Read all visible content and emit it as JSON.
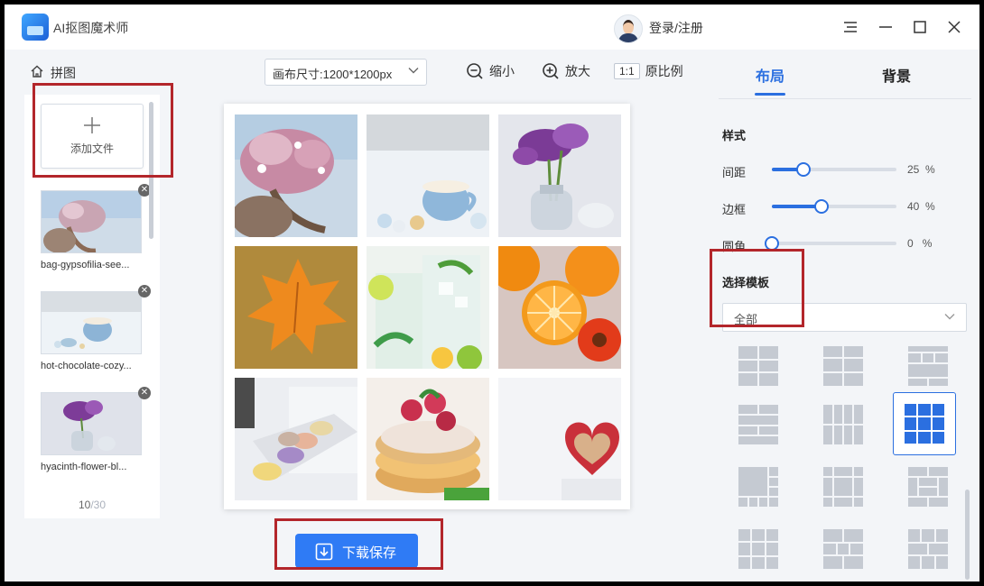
{
  "app": {
    "title": "AI抠图魔术师",
    "login_label": "登录/注册"
  },
  "toolbar": {
    "home_label": "拼图",
    "canvas_size": "画布尺寸:1200*1200px",
    "zoom_out": "缩小",
    "zoom_in": "放大",
    "ratio_box": "1:1",
    "ratio_label": "原比例"
  },
  "files": {
    "add_label": "添加文件",
    "items": [
      {
        "name": "bag-gypsofilia-see..."
      },
      {
        "name": "hot-chocolate-cozy..."
      },
      {
        "name": "hyacinth-flower-bl..."
      }
    ],
    "count_current": "10",
    "count_total": "/30"
  },
  "download_label": "下载保存",
  "panel": {
    "tabs": [
      "布局",
      "背景"
    ],
    "style_title": "样式",
    "sliders": [
      {
        "label": "间距",
        "value": "25",
        "unit": "%",
        "level": 0.25
      },
      {
        "label": "边框",
        "value": "40",
        "unit": "%",
        "level": 0.4
      },
      {
        "label": "圆角",
        "value": "0",
        "unit": "%",
        "level": 0.0
      }
    ],
    "template_title": "选择模板",
    "template_filter": "全部"
  },
  "colors": {
    "accent": "#2b6fe0",
    "highlight_box": "#b3262b",
    "button": "#2f7bf5"
  }
}
